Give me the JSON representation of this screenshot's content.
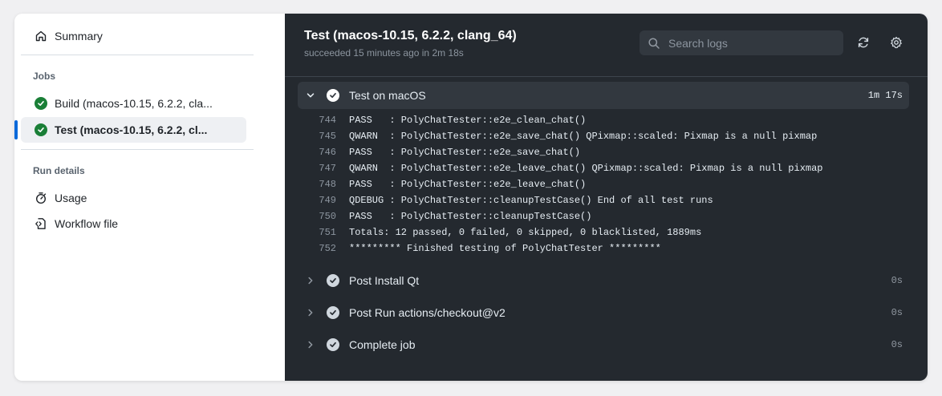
{
  "sidebar": {
    "summary_label": "Summary",
    "jobs_heading": "Jobs",
    "jobs": [
      {
        "label": "Build (macos-10.15, 6.2.2, cla...",
        "status": "success"
      },
      {
        "label": "Test (macos-10.15, 6.2.2, cl...",
        "status": "success",
        "selected": true
      }
    ],
    "run_details_heading": "Run details",
    "usage_label": "Usage",
    "workflow_file_label": "Workflow file"
  },
  "header": {
    "title": "Test (macos-10.15, 6.2.2, clang_64)",
    "subtitle": "succeeded 15 minutes ago in 2m 18s",
    "search_placeholder": "Search logs"
  },
  "steps": [
    {
      "name": "Test on macOS",
      "duration": "1m 17s",
      "expanded": true
    },
    {
      "name": "Post Install Qt",
      "duration": "0s",
      "expanded": false
    },
    {
      "name": "Post Run actions/checkout@v2",
      "duration": "0s",
      "expanded": false
    },
    {
      "name": "Complete job",
      "duration": "0s",
      "expanded": false
    }
  ],
  "log_lines": [
    {
      "num": "744",
      "text": "PASS   : PolyChatTester::e2e_clean_chat()"
    },
    {
      "num": "745",
      "text": "QWARN  : PolyChatTester::e2e_save_chat() QPixmap::scaled: Pixmap is a null pixmap"
    },
    {
      "num": "746",
      "text": "PASS   : PolyChatTester::e2e_save_chat()"
    },
    {
      "num": "747",
      "text": "QWARN  : PolyChatTester::e2e_leave_chat() QPixmap::scaled: Pixmap is a null pixmap"
    },
    {
      "num": "748",
      "text": "PASS   : PolyChatTester::e2e_leave_chat()"
    },
    {
      "num": "749",
      "text": "QDEBUG : PolyChatTester::cleanupTestCase() End of all test runs"
    },
    {
      "num": "750",
      "text": "PASS   : PolyChatTester::cleanupTestCase()"
    },
    {
      "num": "751",
      "text": "Totals: 12 passed, 0 failed, 0 skipped, 0 blacklisted, 1889ms"
    },
    {
      "num": "752",
      "text": "********* Finished testing of PolyChatTester *********"
    }
  ],
  "colors": {
    "success": "#1a7f37",
    "selection_bar": "#0969da",
    "log_background": "#24292f"
  },
  "icons": {
    "summary": "home-icon",
    "status": "check-circle-icon",
    "usage": "stopwatch-icon",
    "workflow_file": "file-code-icon",
    "search": "search-icon",
    "refresh": "sync-icon",
    "settings": "gear-icon"
  }
}
